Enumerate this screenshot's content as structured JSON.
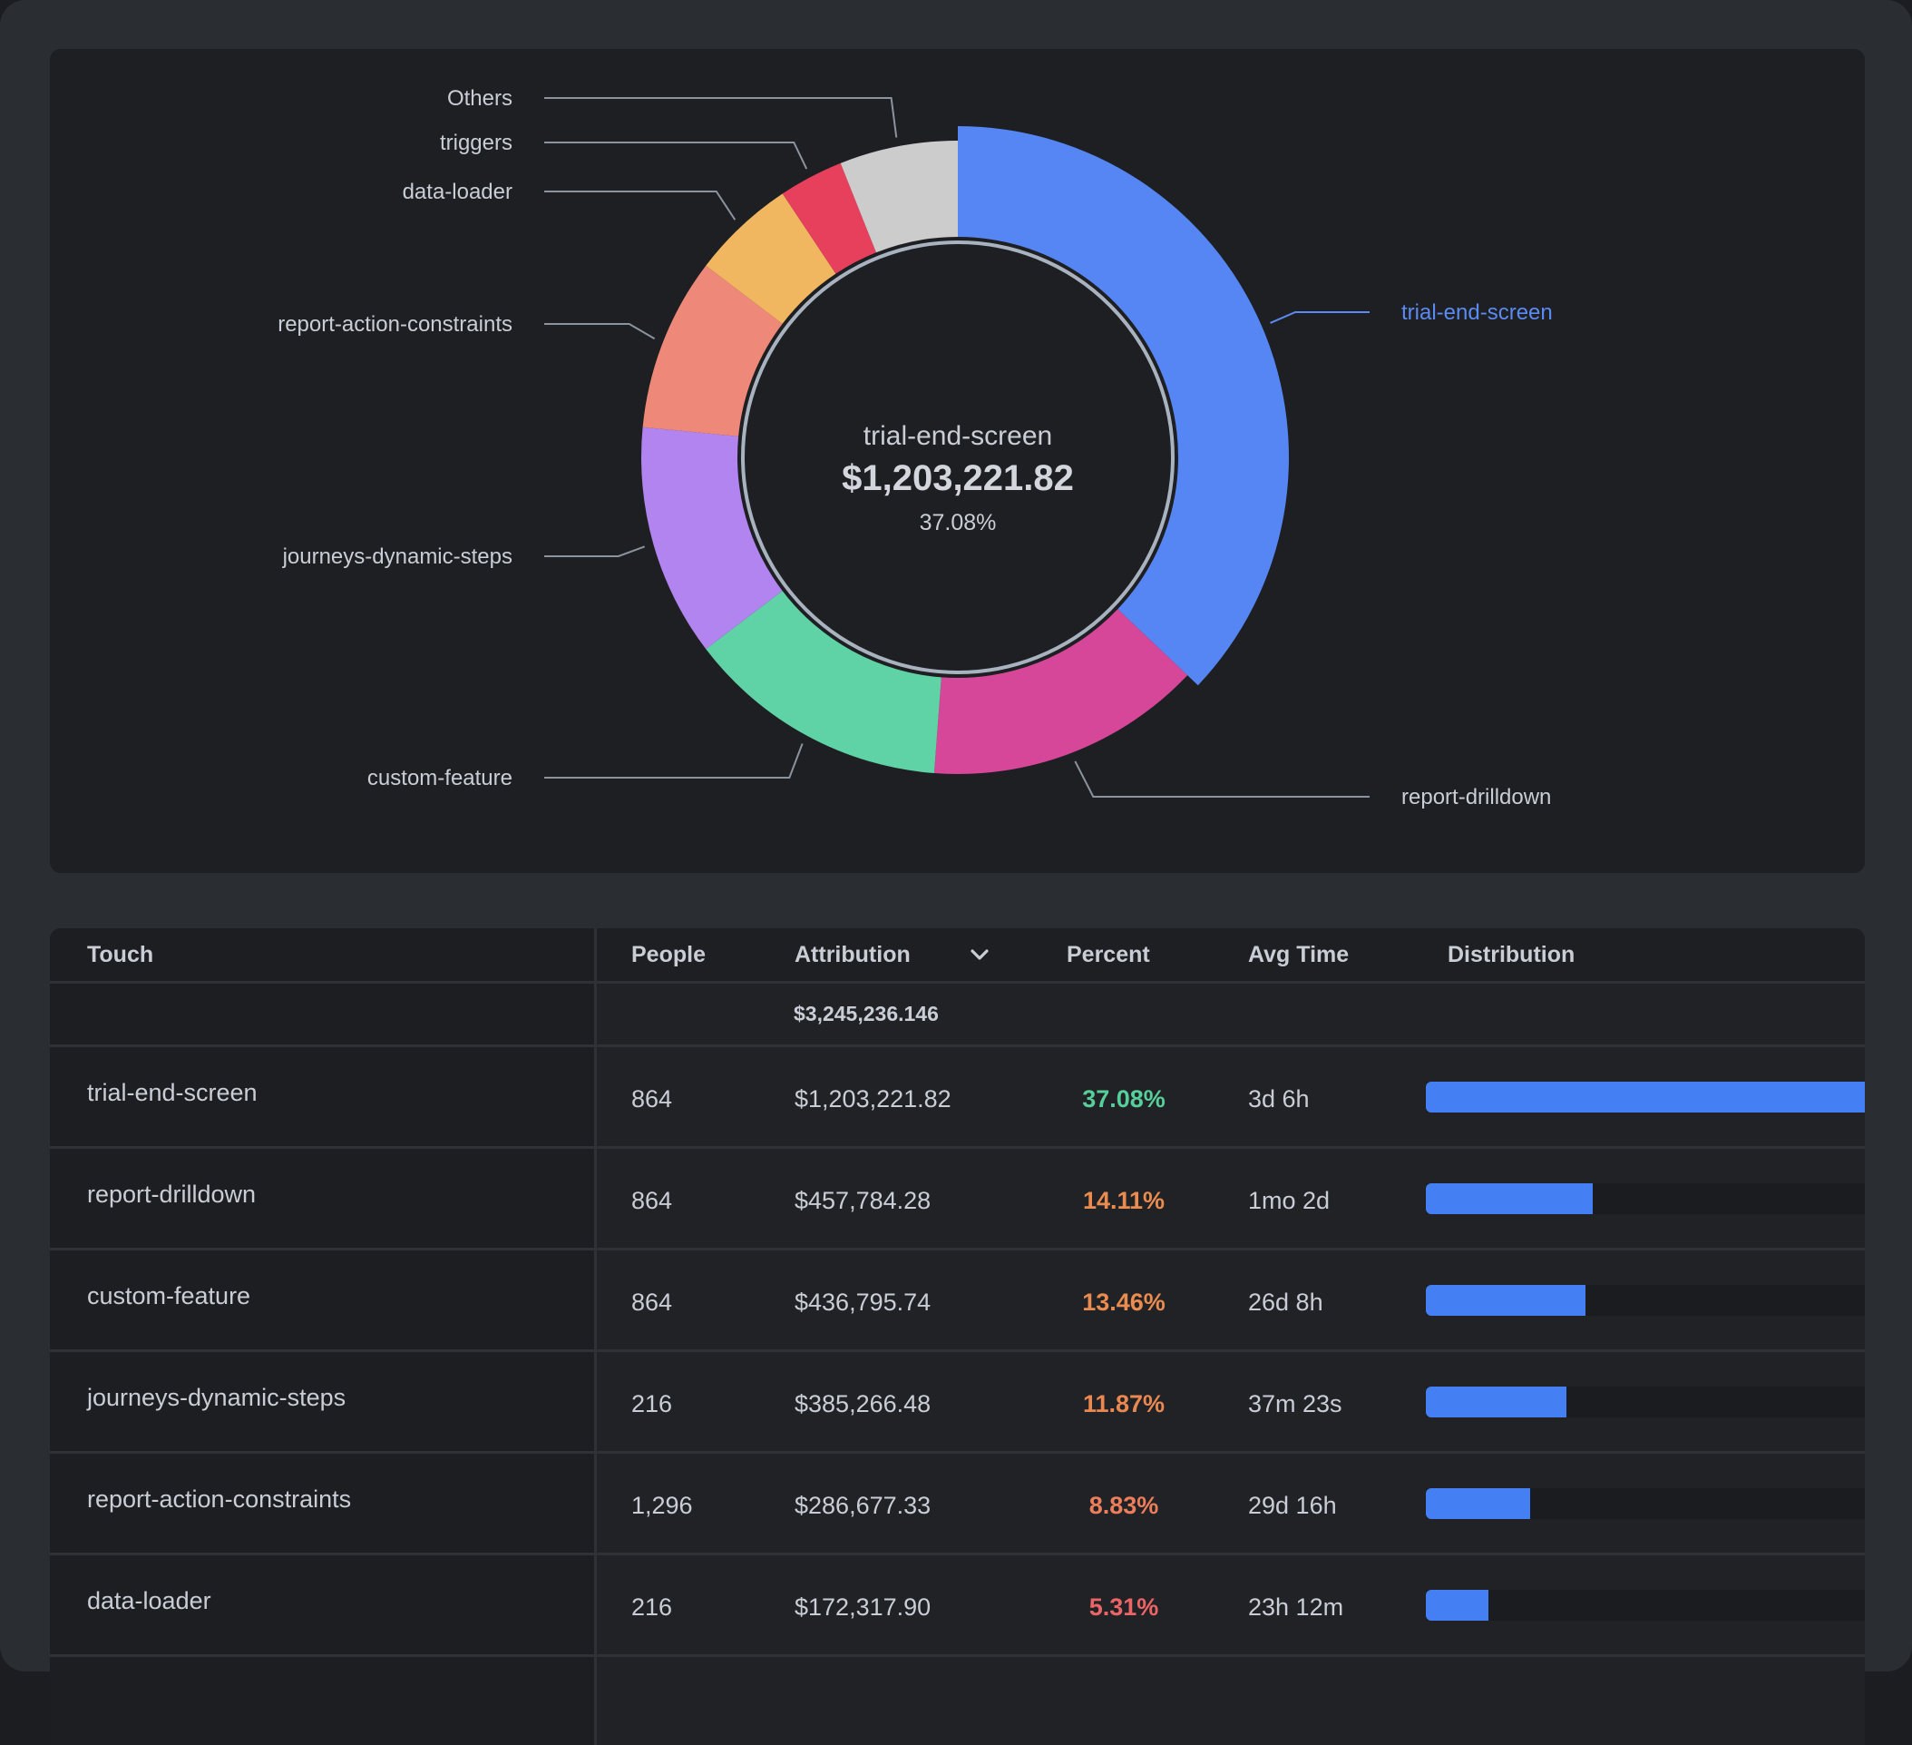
{
  "chart_data": {
    "type": "pie",
    "variant": "donut",
    "title": "",
    "selected_index": 0,
    "center": {
      "label": "trial-end-screen",
      "value": "$1,203,221.82",
      "percent": "37.08%"
    },
    "slices": [
      {
        "label": "trial-end-screen",
        "percent": 37.08,
        "value": 1203221.82,
        "color": "#5586f4"
      },
      {
        "label": "report-drilldown",
        "percent": 14.11,
        "value": 457784.28,
        "color": "#d6479a"
      },
      {
        "label": "custom-feature",
        "percent": 13.46,
        "value": 436795.74,
        "color": "#5fd3a5"
      },
      {
        "label": "journeys-dynamic-steps",
        "percent": 11.87,
        "value": 385266.48,
        "color": "#b284f0"
      },
      {
        "label": "report-action-constraints",
        "percent": 8.83,
        "value": 286677.33,
        "color": "#ee8979"
      },
      {
        "label": "data-loader",
        "percent": 5.31,
        "value": 172317.9,
        "color": "#f0b660"
      },
      {
        "label": "triggers",
        "percent": 3.3,
        "color": "#e6405c"
      },
      {
        "label": "Others",
        "percent": 6.04,
        "color": "#cccccc"
      }
    ]
  },
  "table": {
    "columns": {
      "touch": "Touch",
      "people": "People",
      "attribution": "Attribution",
      "percent": "Percent",
      "avg_time": "Avg Time",
      "distribution": "Distribution"
    },
    "sort_icon": "chevron-down-icon",
    "total_attribution": "$3,245,236.146",
    "rows": [
      {
        "touch": "trial-end-screen",
        "people": "864",
        "attribution": "$1,203,221.82",
        "percent": "37.08%",
        "percent_color": "#56cf9a",
        "avg_time": "3d 6h",
        "distribution": 1.0
      },
      {
        "touch": "report-drilldown",
        "people": "864",
        "attribution": "$457,784.28",
        "percent": "14.11%",
        "percent_color": "#ea8b50",
        "avg_time": "1mo 2d",
        "distribution": 0.3805
      },
      {
        "touch": "custom-feature",
        "people": "864",
        "attribution": "$436,795.74",
        "percent": "13.46%",
        "percent_color": "#ea8b50",
        "avg_time": "26d 8h",
        "distribution": 0.363
      },
      {
        "touch": "journeys-dynamic-steps",
        "people": "216",
        "attribution": "$385,266.48",
        "percent": "11.87%",
        "percent_color": "#ea8852",
        "avg_time": "37m 23s",
        "distribution": 0.3202
      },
      {
        "touch": "report-action-constraints",
        "people": "1,296",
        "attribution": "$286,677.33",
        "percent": "8.83%",
        "percent_color": "#ed7e5c",
        "avg_time": "29d 16h",
        "distribution": 0.2382
      },
      {
        "touch": "data-loader",
        "people": "216",
        "attribution": "$172,317.90",
        "percent": "5.31%",
        "percent_color": "#ec6566",
        "avg_time": "23h 12m",
        "distribution": 0.1432
      }
    ]
  }
}
